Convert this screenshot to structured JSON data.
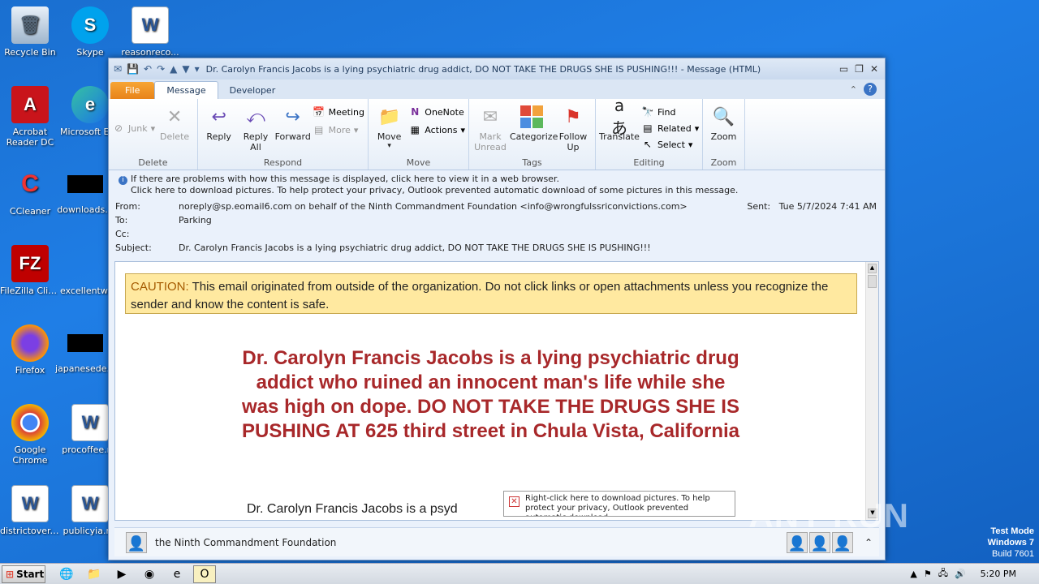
{
  "desktop": {
    "icons": [
      {
        "label": "Recycle Bin"
      },
      {
        "label": "Skype"
      },
      {
        "label": "reasonreco..."
      },
      {
        "label": "Acrobat Reader DC"
      },
      {
        "label": "Microsoft Ed..."
      },
      {
        "label": "CCleaner"
      },
      {
        "label": "downloads..."
      },
      {
        "label": "FileZilla Client"
      },
      {
        "label": "excellentwa..."
      },
      {
        "label": "Firefox"
      },
      {
        "label": "japanesede..."
      },
      {
        "label": "Google Chrome"
      },
      {
        "label": "procoffee.r..."
      },
      {
        "label": "districtover.rtf"
      },
      {
        "label": "publicyia.r..."
      }
    ]
  },
  "window": {
    "title": "Dr. Carolyn Francis Jacobs is a lying psychiatric drug addict, DO NOT TAKE THE DRUGS SHE IS PUSHING!!! - Message (HTML)",
    "tabs": [
      "File",
      "Message",
      "Developer"
    ]
  },
  "ribbon": {
    "delete_group": {
      "label": "Delete",
      "junk": "Junk",
      "delete": "Delete"
    },
    "respond_group": {
      "label": "Respond",
      "reply": "Reply",
      "reply_all": "Reply All",
      "forward": "Forward",
      "meeting": "Meeting",
      "more": "More"
    },
    "move_group": {
      "label": "Move",
      "move": "Move",
      "onenote": "OneNote",
      "actions": "Actions"
    },
    "tags_group": {
      "label": "Tags",
      "mark_unread": "Mark Unread",
      "categorize": "Categorize",
      "follow_up": "Follow Up"
    },
    "editing_group": {
      "label": "Editing",
      "translate": "Translate",
      "find": "Find",
      "related": "Related",
      "select": "Select"
    },
    "zoom_group": {
      "label": "Zoom",
      "zoom": "Zoom"
    }
  },
  "infobar": {
    "line1": "If there are problems with how this message is displayed, click here to view it in a web browser.",
    "line2": "Click here to download pictures. To help protect your privacy, Outlook prevented automatic download of some pictures in this message."
  },
  "header": {
    "from_label": "From:",
    "from_value": "noreply@sp.eomail6.com on behalf of the Ninth Commandment Foundation <info@wrongfulssriconvictions.com>",
    "to_label": "To:",
    "to_value": "Parking",
    "cc_label": "Cc:",
    "cc_value": "",
    "subject_label": "Subject:",
    "subject_value": "Dr. Carolyn Francis Jacobs is a lying psychiatric drug addict, DO NOT TAKE THE DRUGS SHE IS PUSHING!!!",
    "sent_label": "Sent:",
    "sent_value": "Tue 5/7/2024 7:41 AM"
  },
  "body": {
    "caution_word": "CAUTION:",
    "caution_text": " This email originated from outside of the organization. Do not click links or open attachments unless you recognize the sender and know the content is safe.",
    "headline": "Dr. Carolyn Francis Jacobs is a lying psychiatric drug addict who ruined an innocent man's life while she was high on dope. DO NOT TAKE THE DRUGS SHE IS PUSHING AT 625 third street in Chula Vista, California",
    "text_start": "Dr. Carolyn Francis Jacobs is a psyd",
    "image_placeholder": "Right-click here to download pictures.  To help protect your privacy, Outlook prevented automatic download..."
  },
  "people_pane": {
    "sender": "the Ninth Commandment Foundation"
  },
  "taskbar": {
    "start": "Start",
    "clock": "5:20 PM"
  },
  "overlay": {
    "watermark": "ANY RUN",
    "test_mode": "Test Mode",
    "os": "Windows 7",
    "build": "Build 7601"
  }
}
